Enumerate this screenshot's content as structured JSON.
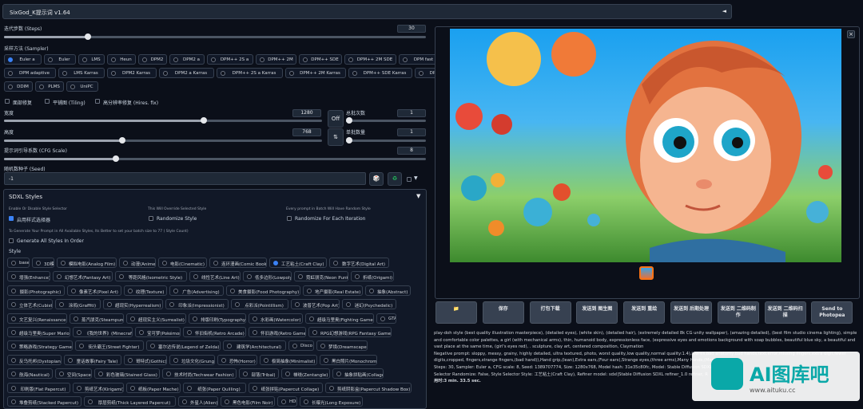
{
  "title_bar": {
    "title": "SixGod_K提示词 v1.64",
    "toggle": "◄"
  },
  "steps": {
    "label": "迭代步数 (Steps)",
    "value": "30"
  },
  "sampler": {
    "label": "采样方法 (Sampler)",
    "row1": [
      "Euler a",
      "Euler",
      "LMS",
      "Heun",
      "DPM2",
      "DPM2 a",
      "DPM++ 2S a",
      "DPM++ 2M",
      "DPM++ SDE",
      "DPM++ 2M SDE",
      "DPM fast"
    ],
    "row2": [
      "DPM adaptive",
      "LMS Karras",
      "DPM2 Karras",
      "DPM2 a Karras",
      "DPM++ 2S a Karras",
      "DPM++ 2M Karras",
      "DPM++ SDE Karras",
      "DPM++ 2M SDE Karras"
    ],
    "row3": [
      "DDIM",
      "PLMS",
      "UniPC"
    ],
    "selected": "Euler a"
  },
  "options": {
    "face": "面部修复",
    "tiling": "平铺图 (Tiling)",
    "hires": "高分辨率修复 (Hires. fix)"
  },
  "width": {
    "label": "宽度",
    "value": "1280"
  },
  "height": {
    "label": "高度",
    "value": "768"
  },
  "batch_count": {
    "label": "总批次数",
    "value": "1"
  },
  "batch_size": {
    "label": "单批数量",
    "value": "1"
  },
  "off_label": "Off",
  "swap_icon": "⇅",
  "cfg": {
    "label": "提示词引导系数 (CFG Scale)",
    "value": "8"
  },
  "seed": {
    "label": "随机数种子 (Seed)",
    "value": "-1",
    "dice": "🎲",
    "recycle": "♻",
    "arrow": "▼"
  },
  "sdxl": {
    "title": "SDXL Styles",
    "arrow": "▼",
    "enable_hint": "Enable Or Disable Style Selector",
    "enable_label": "启用样式选择器",
    "overwrite_hint": "This Will Override Selected Style",
    "random_label": "Randomize Style",
    "batch_hint": "Every prompt in Batch Will Have Random Style",
    "random_iter_label": "Randomize For Each Iteration",
    "gen_hint": "To Generate Your Prompt in All Available Styles, Its Better to set your batch size to 77 ( Style Count)",
    "gen_all_label": "Generate All Styles In Order",
    "style_label": "Style",
    "selected": "工艺粘土(Craft Clay)",
    "styles": [
      [
        "base",
        "3D模型",
        "模拟电影(Analog Film)",
        "动漫(Anime)",
        "电影(Cinematic)",
        "连环漫画(Comic Book)",
        "工艺粘土(Craft Clay)",
        "数字艺术(Digital Art)"
      ],
      [
        "增强(Enhance)",
        "幻想艺术(Fantasy Art)",
        "等距风格(Isometric Style)",
        "线性艺术(Line Art)",
        "低多边形(Lowpoly)",
        "霓虹朋克(Neon Punk)",
        "折纸(Origami)"
      ],
      [
        "摄影(Photographic)",
        "像素艺术(Pixel Art)",
        "纹理(Texture)",
        "广告(Advertising)",
        "美食摄影(Food Photography)",
        "地产摄影(Real Estate)",
        "抽象(Abstract)"
      ],
      [
        "立体艺术(Cubist)",
        "涂鸦(Graffiti)",
        "超现实(Hyperrealism)",
        "印象派(Impressionist)",
        "点彩派(Pointillism)",
        "波普艺术(Pop Art)",
        "迷幻(Psychedelic)"
      ],
      [
        "文艺复兴(Renaissance)",
        "蒸汽朋克(Steampunk)",
        "超现实主义(Surrealist)",
        "排版印刷(Typography)",
        "水彩画(Watercolor)",
        "超级马里奥(Fighting Game)",
        "GTA"
      ],
      [
        "超级马里奥(Super Mario)",
        "《我的世界》(Minecraft)",
        "宝可梦(Pokémon)",
        "怀旧街机(Retro Arcade)",
        "怀旧游戏(Retro Game)",
        "RPG幻想游戏(RPG Fantasy Game)"
      ],
      [
        "策略游戏(Strategy Game)",
        "街头霸王(Street Fighter)",
        "塞尔达传说(Legend of Zelda)",
        "建筑学(Architectural)",
        "Disco",
        "梦境(Dreamscape)"
      ],
      [
        "反乌托邦(Dystopian)",
        "童话故事(Fairy Tale)",
        "哥特式(Gothic)",
        "垃圾文化(Grunge)",
        "恐怖(Horror)",
        "极简抽象(Minimalist)",
        "黑白照片(Monochrome)"
      ],
      [
        "航海(Nautical)",
        "空间(Space)",
        "彩色玻璃(Stained Glass)",
        "技术时尚(Techwear Fashion)",
        "部落(Tribal)",
        "禅绕(Zentangle)",
        "抽象拼贴画(Collage)"
      ],
      [
        "印刷版(Flat Papercut)",
        "剪纸艺术(Kirigami)",
        "纸板(Paper Mache)",
        "纸张(Paper Quilling)",
        "纸张拼贴(Papercut Collage)",
        "剪纸阴影盒(Papercut Shadow Box)"
      ],
      [
        "堆叠剪纸(Stacked Papercut)",
        "厚层剪纸(Thick Layered Papercut)",
        "外星人(Alien)",
        "黑色电影(Film Noir)",
        "HDR",
        "长曝光(Long Exposure)"
      ]
    ]
  },
  "image_panel": {
    "close": "×"
  },
  "actions": [
    "📁",
    "保存",
    "打包下载",
    "发送到 图生图",
    "发送到 重绘",
    "发送到 后期处理",
    "发送到 二维码制作",
    "发送到 二维码扫描",
    "Send to Photopea"
  ],
  "info": [
    "play-doh style (best quality illustration masterpiece), (detailed eyes), (white skin), (detailed hair), (extremely detailed 8k CG unity wallpaper), (amazing detailed), (best film studio cinema lighting), simple and comfortable color palettes, a girl (with mechanical arms), thin, humanoid body, expressionless face, (expressive eyes and emotions background with soap bubbles, beautiful blue sky, a beautiful and vast place at the same time, (girl's eyes red), . sculpture, clay art, centered composition, Claymation",
    "Negative prompt: sloppy, messy, grainy, highly detailed, ultra textured, photo, worst quality,low quality,normal quality:1.4),lowres,bad anatomy,bad hands,text,error,missing fingers,extra digit,fewer digits,cropped, fingers,strange fingers,(bad hand)),Hand grip,(lean),Extra ears,(Four ears),Strange eyes,(three arms),Many hands,(Many arms),",
    "Steps: 30, Sampler: Euler a, CFG scale: 8, Seed: 1389707774, Size: 1280x768, Model hash: 31e35c80fc, Model: Stable Diffusion SDXL base",
    "Selector Randomize: False, Style Selector Style: 工艺粘土(Craft Clay), Refiner model: sdxl|Stable Diffusion SDXL refiner_1.0 refiner, R",
    "用时:3 min. 33.5 sec."
  ],
  "watermark": {
    "brand": "AI图库吧",
    "url": "www.aituku.cc"
  }
}
